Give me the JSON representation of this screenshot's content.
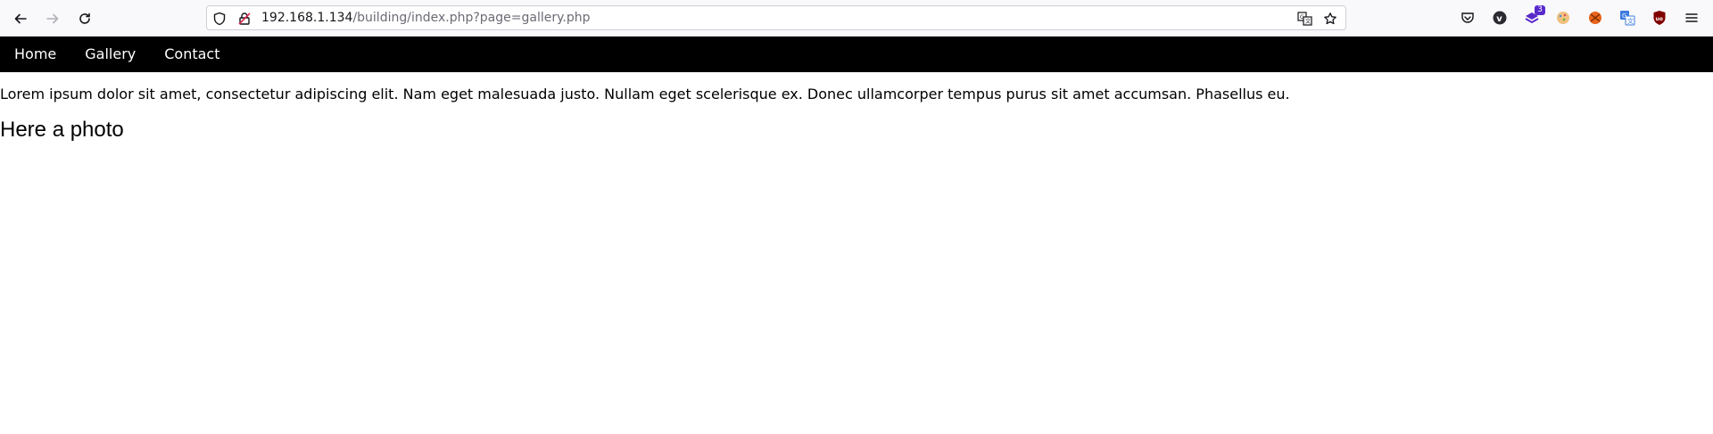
{
  "browser": {
    "url_host": "192.168.1.134",
    "url_path": "/building/index.php?page=gallery.php",
    "icons": [
      "back-arrow-icon",
      "forward-arrow-icon",
      "reload-icon",
      "shield-icon",
      "insecure-lock-icon",
      "translate-icon",
      "bookmark-star-icon",
      "pocket-icon",
      "extension-v-icon",
      "extension-stack-icon",
      "extension-cookie-icon",
      "extension-ball-icon",
      "extension-translate-icon",
      "ublock-icon",
      "menu-icon"
    ],
    "extension_badge": "3"
  },
  "nav": {
    "items": [
      {
        "label": "Home"
      },
      {
        "label": "Gallery"
      },
      {
        "label": "Contact"
      }
    ],
    "background": "#000000",
    "text_color": "#ffffff"
  },
  "main": {
    "paragraph": "Lorem ipsum dolor sit amet, consectetur adipiscing elit. Nam eget malesuada justo. Nullam eget scelerisque ex. Donec ullamcorper tempus purus sit amet accumsan. Phasellus eu.",
    "heading": "Here a photo"
  }
}
